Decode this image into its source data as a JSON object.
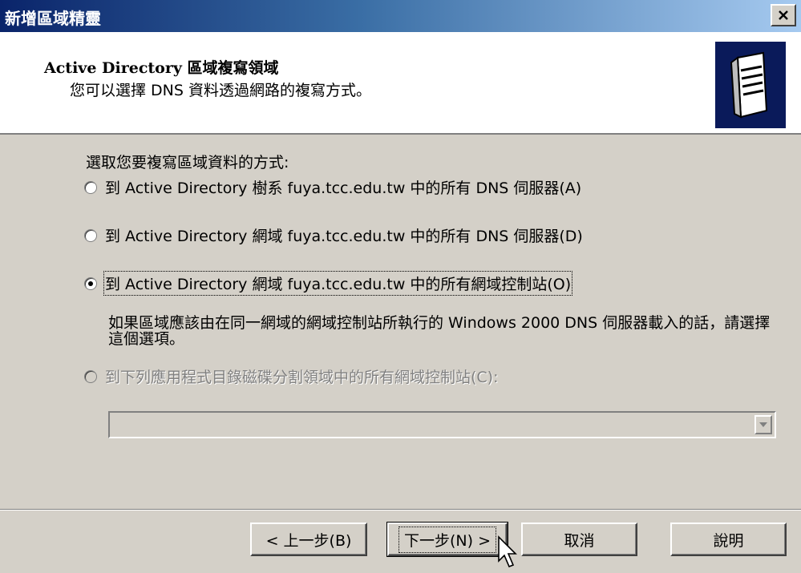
{
  "window": {
    "title": "新增區域精靈"
  },
  "header": {
    "title": "Active Directory 區域複寫領域",
    "subtitle": "您可以選擇 DNS 資料透過網路的複寫方式。"
  },
  "content": {
    "prompt": "選取您要複寫區域資料的方式:",
    "options": [
      {
        "label": "到 Active Directory 樹系 fuya.tcc.edu.tw 中的所有 DNS 伺服器(A)",
        "selected": false,
        "enabled": true
      },
      {
        "label": "到 Active Directory 網域 fuya.tcc.edu.tw 中的所有 DNS 伺服器(D)",
        "selected": false,
        "enabled": true
      },
      {
        "label": "到 Active Directory 網域 fuya.tcc.edu.tw 中的所有網域控制站(O)",
        "selected": true,
        "enabled": true
      },
      {
        "label": "到下列應用程式目錄磁碟分割領域中的所有網域控制站(C):",
        "selected": false,
        "enabled": false
      }
    ],
    "note": "如果區域應該由在同一網域的網域控制站所執行的 Windows 2000 DNS 伺服器載入的話，請選擇這個選項。",
    "combo_value": ""
  },
  "buttons": {
    "back": "< 上一步(B)",
    "next": "下一步(N) >",
    "cancel": "取消",
    "help": "說明"
  },
  "colors": {
    "title_start": "#0a246a",
    "title_end": "#a6caf0",
    "face": "#d4d0c8"
  }
}
